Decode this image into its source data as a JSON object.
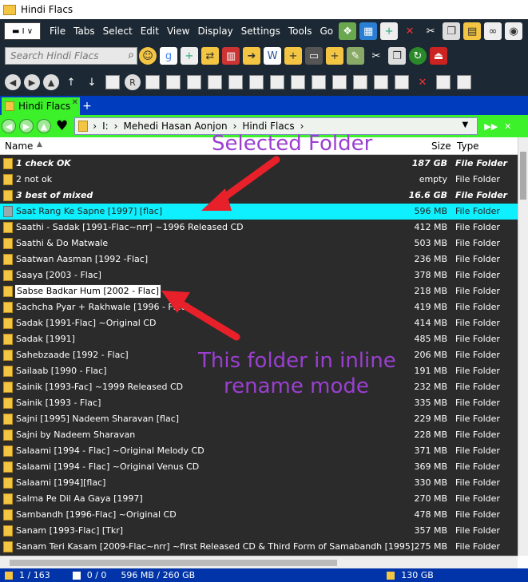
{
  "title": "Hindi Flacs",
  "address_combo": "▬ I ∨",
  "menu": [
    "File",
    "Tabs",
    "Select",
    "Edit",
    "View",
    "Display",
    "Settings",
    "Tools",
    "Go"
  ],
  "search": {
    "placeholder": "Search Hindi Flacs"
  },
  "tab": {
    "label": "Hindi Flacs"
  },
  "breadcrumb": [
    "I:",
    "Mehedi Hasan Aonjon",
    "Hindi Flacs"
  ],
  "columns": {
    "name": "Name",
    "size": "Size",
    "type": "Type"
  },
  "rows": [
    {
      "name": "1 check OK",
      "size": "187 GB",
      "type": "File Folder"
    },
    {
      "name": "2 not ok",
      "size": "empty",
      "type": "File Folder"
    },
    {
      "name": "3 best of mixed",
      "size": "16.6 GB",
      "type": "File Folder"
    },
    {
      "name": "Saat Rang Ke Sapne [1997] [flac]",
      "size": "596 MB",
      "type": "File Folder"
    },
    {
      "name": "Saathi - Sadak [1991-Flac~nrr] ~1996 Released CD",
      "size": "412 MB",
      "type": "File Folder"
    },
    {
      "name": "Saathi & Do Matwale",
      "size": "503 MB",
      "type": "File Folder"
    },
    {
      "name": "Saatwan Aasman [1992 -Flac]",
      "size": "236 MB",
      "type": "File Folder"
    },
    {
      "name": "Saaya [2003 - Flac]",
      "size": "378 MB",
      "type": "File Folder"
    },
    {
      "name": "Sabse Badkar Hum [2002 - Flac]",
      "size": "218 MB",
      "type": "File Folder"
    },
    {
      "name": "Sachcha Pyar + Rakhwale [1996 - Flac]",
      "size": "419 MB",
      "type": "File Folder"
    },
    {
      "name": "Sadak [1991-Flac] ~Original CD",
      "size": "414 MB",
      "type": "File Folder"
    },
    {
      "name": "Sadak [1991]",
      "size": "485 MB",
      "type": "File Folder"
    },
    {
      "name": "Sahebzaade [1992 - Flac]",
      "size": "206 MB",
      "type": "File Folder"
    },
    {
      "name": "Sailaab [1990 - Flac]",
      "size": "191 MB",
      "type": "File Folder"
    },
    {
      "name": "Sainik [1993-Fac] ~1999 Released CD",
      "size": "232 MB",
      "type": "File Folder"
    },
    {
      "name": "Sainik [1993 - Flac]",
      "size": "335 MB",
      "type": "File Folder"
    },
    {
      "name": "Sajni [1995] Nadeem Sharavan [flac]",
      "size": "229 MB",
      "type": "File Folder"
    },
    {
      "name": "Sajni by Nadeem Sharavan",
      "size": "228 MB",
      "type": "File Folder"
    },
    {
      "name": "Salaami [1994 - Flac] ~Original Melody CD",
      "size": "371 MB",
      "type": "File Folder"
    },
    {
      "name": "Salaami [1994 - Flac] ~Original Venus CD",
      "size": "369 MB",
      "type": "File Folder"
    },
    {
      "name": "Salaami [1994][flac]",
      "size": "330 MB",
      "type": "File Folder"
    },
    {
      "name": "Salma Pe Dil Aa Gaya [1997]",
      "size": "270 MB",
      "type": "File Folder"
    },
    {
      "name": "Sambandh [1996-Flac] ~Original CD",
      "size": "478 MB",
      "type": "File Folder"
    },
    {
      "name": "Sanam [1993-Flac] [Tkr]",
      "size": "357 MB",
      "type": "File Folder"
    },
    {
      "name": "Sanam Teri Kasam [2009-Flac~nrr] ~first Released CD & Third Form of Samabandh [1995]",
      "size": "275 MB",
      "type": "File Folder"
    }
  ],
  "annotations": {
    "selected": "Selected Folder",
    "rename_line1": "This folder in inline",
    "rename_line2": "rename mode"
  },
  "status": {
    "count": "1 / 163",
    "sel": "0 / 0",
    "size": "596 MB / 260 GB",
    "free": "130 GB"
  },
  "colors": {
    "selected_row": "#0ef0ff",
    "annotation": "#9b3fd1",
    "tab": "#3cf02a",
    "list_bg": "#2b2b2b"
  }
}
